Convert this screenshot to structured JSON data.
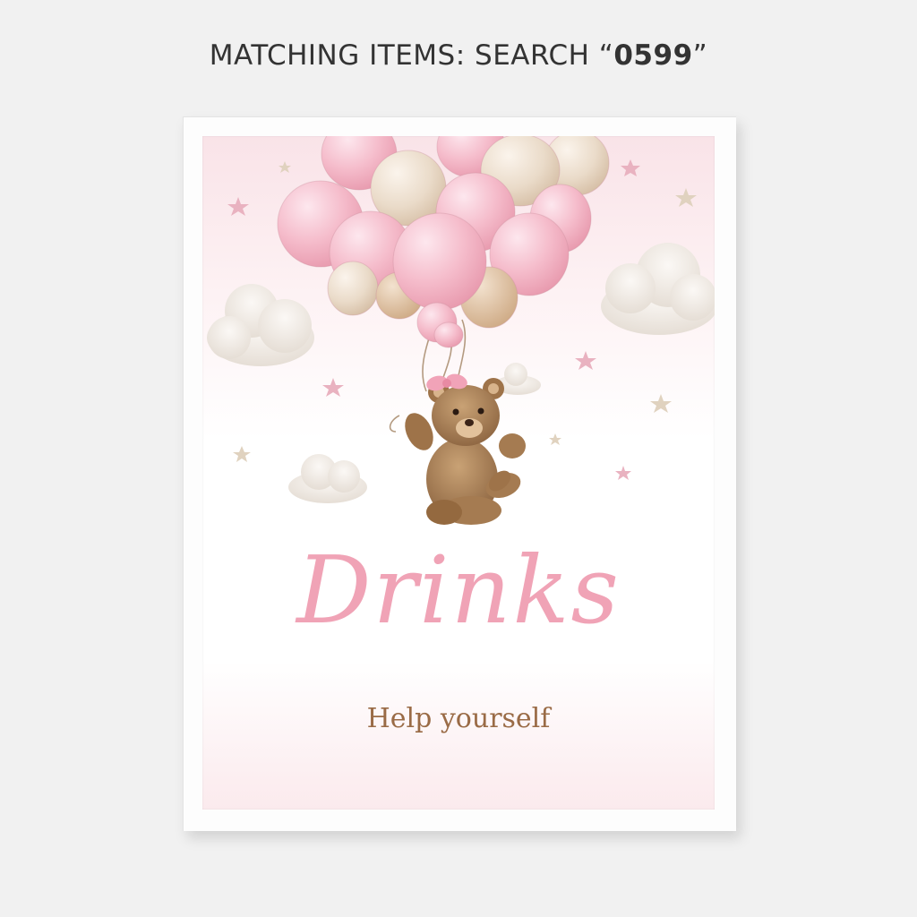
{
  "header": {
    "prefix": "MATCHING ITEMS: SEARCH “",
    "code": "0599",
    "suffix": "”"
  },
  "poster": {
    "title": "Drinks",
    "subtitle": "Help yourself",
    "colors": {
      "title": "#f0a3b6",
      "subtitle": "#9a6b46",
      "balloon_pink": "#f4b9c8",
      "balloon_beige": "#ecd9c4",
      "bear": "#a77c50"
    },
    "icons": [
      "balloons-cluster",
      "teddy-bear",
      "pink-bow",
      "cloud",
      "star"
    ]
  }
}
